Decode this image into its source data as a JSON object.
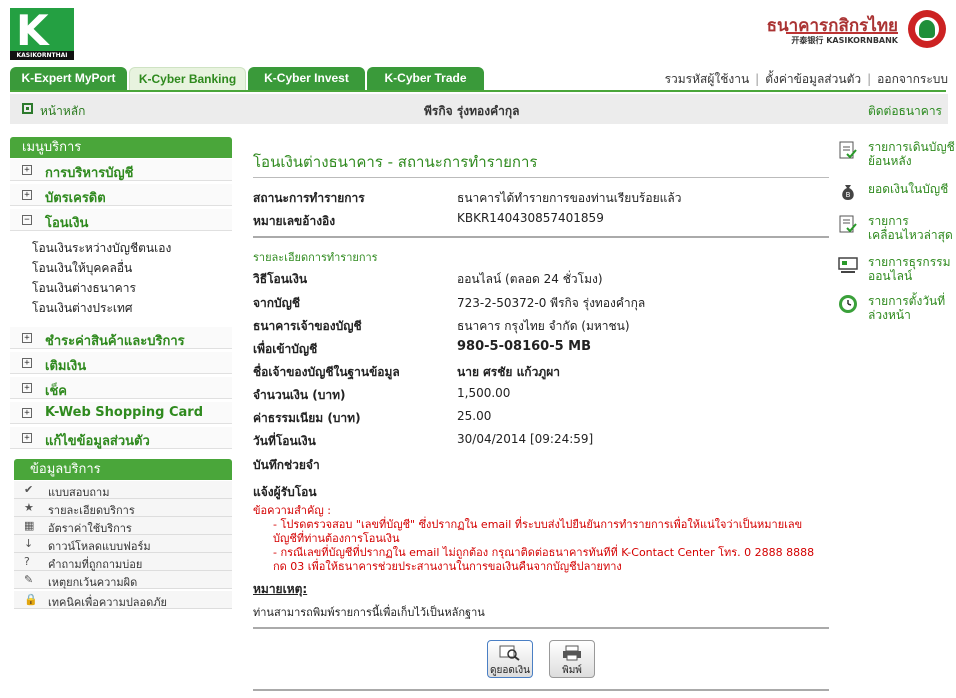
{
  "header": {
    "logo_text": "K",
    "logo_caption": "KASIKORNTHAI",
    "bank_name_th": "ธนาคารกสิกรไทย",
    "bank_name_en": "开泰银行 KASIKORNBANK"
  },
  "tabs": [
    {
      "label": "K-Expert MyPort"
    },
    {
      "label": "K-Cyber Banking"
    },
    {
      "label": "K-Cyber Invest"
    },
    {
      "label": "K-Cyber Trade"
    }
  ],
  "top_links": [
    "รวมรหัสผู้ใช้งาน",
    "ตั้งค่าข้อมูลส่วนตัว",
    "ออกจากระบบ"
  ],
  "subbar": {
    "home": "หน้าหลัก",
    "user": "พีรกิจ รุ่งทองคำกุล",
    "contact": "ติดต่อธนาคาร"
  },
  "menu": {
    "title": "เมนูบริการ",
    "groups_top": [
      {
        "box": "+",
        "label": "การบริหารบัญชี"
      },
      {
        "box": "+",
        "label": "บัตรเครดิต"
      },
      {
        "box": "−",
        "label": "โอนเงิน"
      }
    ],
    "transfer_items": [
      "โอนเงินระหว่างบัญชีตนเอง",
      "โอนเงินให้บุคคลอื่น",
      "โอนเงินต่างธนาคาร",
      "โอนเงินต่างประเทศ"
    ],
    "groups_bottom": [
      {
        "box": "+",
        "label": "ชำระค่าสินค้าและบริการ"
      },
      {
        "box": "+",
        "label": "เติมเงิน"
      },
      {
        "box": "+",
        "label": "เช็ค"
      },
      {
        "box": "+",
        "label": "K-Web Shopping Card"
      },
      {
        "box": "+",
        "label": "แก้ไขข้อมูลส่วนตัว"
      }
    ]
  },
  "info": {
    "title": "ข้อมูลบริการ",
    "items": [
      {
        "icon": "✔",
        "label": "แบบสอบถาม"
      },
      {
        "icon": "★",
        "label": "รายละเอียดบริการ"
      },
      {
        "icon": "▦",
        "label": "อัตราค่าใช้บริการ"
      },
      {
        "icon": "↓",
        "label": "ดาวน์โหลดแบบฟอร์ม"
      },
      {
        "icon": "?",
        "label": "คำถามที่ถูกถามบ่อย"
      },
      {
        "icon": "✎",
        "label": "เหตุยกเว้นความผิด"
      },
      {
        "icon": "🔒",
        "label": "เทคนิคเพื่อความปลอดภัย"
      }
    ]
  },
  "main": {
    "title": "โอนเงินต่างธนาคาร - สถานะการทำรายการ",
    "status_label": "สถานะการทำรายการ",
    "status_value": "ธนาคารได้ทำรายการของท่านเรียบร้อยแล้ว",
    "ref_label": "หมายเลขอ้างอิง",
    "ref_value": "KBKR140430857401859",
    "details_title": "รายละเอียดการทำรายการ",
    "rows": [
      {
        "label": "วิธีโอนเงิน",
        "value": "ออนไลน์ (ตลอด 24 ชั่วโมง)"
      },
      {
        "label": "จากบัญชี",
        "value": "723-2-50372-0 พีรกิจ รุ่งทองคำกุล"
      },
      {
        "label": "ธนาคารเจ้าของบัญชี",
        "value": "ธนาคาร กรุงไทย จำกัด (มหาชน)"
      },
      {
        "label": "เพื่อเข้าบัญชี",
        "value": "980-5-08160-5 MB"
      },
      {
        "label": "ชื่อเจ้าของบัญชีในฐานข้อมูล",
        "value": "นาย ศรชัย แก้วภูผา"
      },
      {
        "label": "จำนวนเงิน (บาท)",
        "value": "1,500.00"
      },
      {
        "label": "ค่าธรรมเนียม (บาท)",
        "value": "25.00"
      },
      {
        "label": "วันที่โอนเงิน",
        "value": "30/04/2014 [09:24:59]"
      },
      {
        "label": "บันทึกช่วยจำ",
        "value": ""
      }
    ],
    "notify_label": "แจ้งผู้รับโอน",
    "note_title": "ข้อความสำคัญ :",
    "note_1": "- โปรดตรวจสอบ \"เลขที่บัญชี\" ซึ่งปรากฏใน email ที่ระบบส่งไปยืนยันการทำรายการเพื่อให้แน่ใจว่าเป็นหมายเลขบัญชีที่ท่านต้องการโอนเงิน",
    "note_2": "- กรณีเลขที่บัญชีที่ปรากฏใน email ไม่ถูกต้อง กรุณาติดต่อธนาคารทันทีที่ K-Contact Center โทร. 0 2888 8888 กด 03 เพื่อให้ธนาคารช่วยประสานงานในการขอเงินคืนจากบัญชีปลายทาง",
    "remark_title": "หมายเหตุ:",
    "remark_text": "ท่านสามารถพิมพ์รายการนี้เพื่อเก็บไว้เป็นหลักฐาน",
    "btn_view": "ดูยอดเงิน",
    "btn_print": "พิมพ์"
  },
  "right_links": [
    {
      "icon": "statement-icon",
      "label": "รายการเดินบัญชีย้อนหลัง"
    },
    {
      "icon": "balance-icon",
      "label": "ยอดเงินในบัญชี"
    },
    {
      "icon": "recent-icon",
      "label": "รายการเคลื่อนไหวล่าสุด"
    },
    {
      "icon": "online-icon",
      "label": "รายการธุรกรรมออนไลน์"
    },
    {
      "icon": "clock-icon",
      "label": "รายการตั้งวันที่ล่วงหน้า"
    }
  ],
  "colors": {
    "brand_green": "#2f8a1e",
    "accent_red": "#d40000"
  }
}
